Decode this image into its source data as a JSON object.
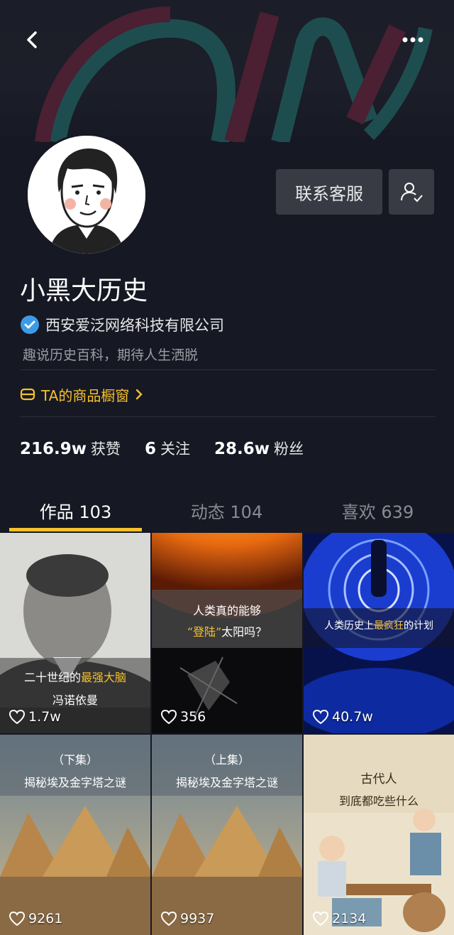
{
  "header": {
    "back_icon": "back-chevron-icon",
    "more_icon": "more-dots-icon"
  },
  "profile": {
    "name": "小黑大历史",
    "verified_company": "西安爱泛网络科技有限公司",
    "bio": "趣说历史百科，期待人生洒脱",
    "contact_button": "联系客服",
    "shop_link": "TA的商品橱窗"
  },
  "stats": [
    {
      "value": "216.9w",
      "label": "获赞"
    },
    {
      "value": "6",
      "label": "关注"
    },
    {
      "value": "28.6w",
      "label": "粉丝"
    }
  ],
  "tabs": [
    {
      "label": "作品 103",
      "active": true
    },
    {
      "label": "动态 104",
      "active": false
    },
    {
      "label": "喜欢 639",
      "active": false
    }
  ],
  "videos": [
    {
      "likes": "1.7w",
      "caption_line1_pre": "二十世纪的",
      "caption_line1_hl": "最强大脑",
      "caption_line2": "冯诺依曼"
    },
    {
      "likes": "356",
      "caption_line1": "人类真的能够",
      "caption_line2_hl": "“登陆”",
      "caption_line2_post": "太阳吗？"
    },
    {
      "likes": "40.7w",
      "caption_pre": "人类历史上",
      "caption_hl": "最疯狂",
      "caption_post": "的计划"
    },
    {
      "likes": "9261",
      "caption_line1": "（下集）",
      "caption_line2": "揭秘埃及金字塔之谜"
    },
    {
      "likes": "9937",
      "caption_line1": "（上集）",
      "caption_line2": "揭秘埃及金字塔之谜"
    },
    {
      "likes": "2134",
      "caption_line1": "古代人",
      "caption_line2": "到底都吃些什么"
    }
  ],
  "colors": {
    "background": "#161823",
    "accent": "#f6c12d",
    "verified": "#3c9be8",
    "button": "#393b44"
  }
}
